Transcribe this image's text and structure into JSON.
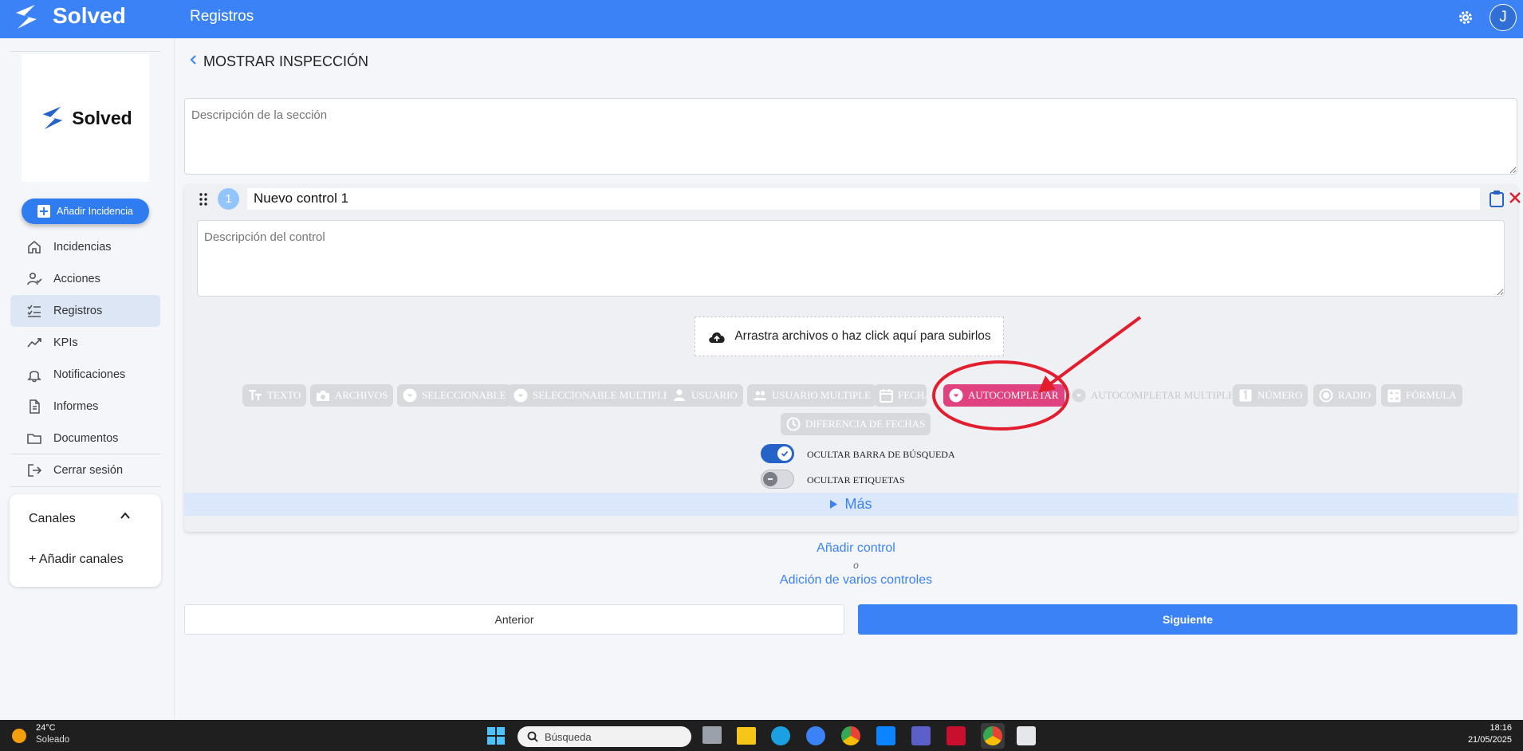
{
  "app": {
    "brand": "Solved",
    "page_title": "Registros",
    "user_initial": "J",
    "accent": "#3b82f6"
  },
  "sidebar": {
    "logo_text": "Solved",
    "add_incident_label": "Añadir Incidencia",
    "items": [
      {
        "label": "Incidencias",
        "icon": "home-icon"
      },
      {
        "label": "Acciones",
        "icon": "user-check-icon"
      },
      {
        "label": "Registros",
        "icon": "checklist-icon",
        "active": true
      },
      {
        "label": "KPIs",
        "icon": "trend-icon"
      },
      {
        "label": "Notificaciones",
        "icon": "bell-icon"
      },
      {
        "label": "Informes",
        "icon": "document-icon"
      },
      {
        "label": "Documentos",
        "icon": "folder-icon"
      }
    ],
    "logout_label": "Cerrar sesión",
    "channels": {
      "title": "Canales",
      "add_label": "+ Añadir canales"
    }
  },
  "main": {
    "back_title": "MOSTRAR INSPECCIÓN",
    "section_description_placeholder": "Descripción de la sección",
    "control": {
      "number": "1",
      "name": "Nuevo control 1",
      "description_placeholder": "Descripción del control",
      "upload_label": "Arrastra archivos o haz click aquí para subirlos",
      "types": [
        {
          "label": "TEXTO",
          "icon": "text-size-icon",
          "selected": false
        },
        {
          "label": "ARCHIVOS",
          "icon": "camera-icon",
          "selected": false
        },
        {
          "label": "SELECCIONABLE",
          "icon": "dropdown-icon",
          "selected": false
        },
        {
          "label": "SELECCIONABLE MULTIPLE",
          "icon": "dropdown-icon",
          "selected": false
        },
        {
          "label": "USUARIO",
          "icon": "person-icon",
          "selected": false
        },
        {
          "label": "USUARIO MULTIPLE",
          "icon": "people-icon",
          "selected": false
        },
        {
          "label": "FECHA",
          "icon": "calendar-icon",
          "selected": false
        },
        {
          "label": "AUTOCOMPLETAR",
          "icon": "dropdown-icon",
          "selected": true
        },
        {
          "label": "AUTOCOMPLETAR MULTIPLE",
          "icon": "dropdown-icon",
          "selected": false
        },
        {
          "label": "NÚMERO",
          "icon": "number-icon",
          "selected": false
        },
        {
          "label": "RADIO",
          "icon": "radio-icon",
          "selected": false
        },
        {
          "label": "FÓRMULA",
          "icon": "formula-icon",
          "selected": false
        },
        {
          "label": "DIFERENCIA DE FECHAS",
          "icon": "timer-icon",
          "selected": false
        }
      ],
      "selected_color": "#e0417f",
      "toggles": [
        {
          "label": "OCULTAR BARRA DE BÚSQUEDA",
          "on": true
        },
        {
          "label": "OCULTAR ETIQUETAS",
          "on": false
        }
      ],
      "more_label": "Más"
    },
    "add_control_label": "Añadir control",
    "or_label": "o",
    "add_multiple_label": "Adición de varios controles",
    "prev_label": "Anterior",
    "next_label": "Siguiente"
  },
  "taskbar": {
    "weather_temp": "24°C",
    "weather_desc": "Soleado",
    "search_placeholder": "Búsqueda",
    "time": "18:16",
    "date": "21/05/2025"
  }
}
